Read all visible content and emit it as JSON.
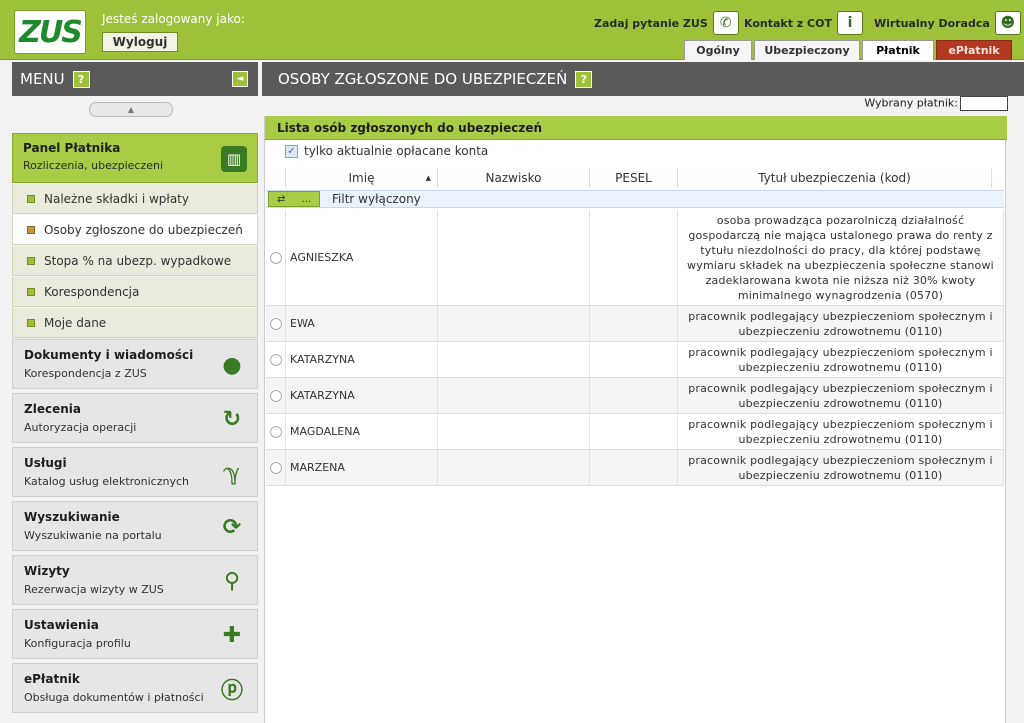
{
  "header": {
    "logo_text": "ZUS",
    "logged_as_label": "Jesteś zalogowany jako:",
    "logout_label": "Wyloguj",
    "links": [
      {
        "label": "Zadaj pytanie ZUS",
        "icon": "chat-bubble-icon"
      },
      {
        "label": "Kontakt z COT",
        "icon": "info-icon"
      },
      {
        "label": "Wirtualny Doradca",
        "icon": "user-icon"
      }
    ],
    "tabs": [
      {
        "label": "Ogólny",
        "state": "normal"
      },
      {
        "label": "Ubezpieczony",
        "state": "normal"
      },
      {
        "label": "Płatnik",
        "state": "active"
      },
      {
        "label": "ePłatnik",
        "state": "red"
      }
    ],
    "accent_color": "#9dc23a",
    "red_tab_color": "#b33821"
  },
  "sidebar": {
    "menu_title": "MENU",
    "help_label": "?",
    "collapse_glyph": "◄",
    "scroll_up_glyph": "▲",
    "panel": {
      "title": "Panel Płatnika",
      "subtitle": "Rozliczenia, ubezpieczeni",
      "icon": "document-stack-icon"
    },
    "items": [
      {
        "label": "Należne składki i wpłaty",
        "selected": false
      },
      {
        "label": "Osoby zgłoszone do ubezpieczeń",
        "selected": true
      },
      {
        "label": "Stopa % na ubezp. wypadkowe",
        "selected": false
      },
      {
        "label": "Korespondencja",
        "selected": false
      },
      {
        "label": "Moje dane",
        "selected": false
      }
    ],
    "groups": [
      {
        "title": "Dokumenty i wiadomości",
        "subtitle": "Korespondencja z ZUS",
        "icon": "speech-bubble-icon"
      },
      {
        "title": "Zlecenia",
        "subtitle": "Autoryzacja operacji",
        "icon": "refresh-icon"
      },
      {
        "title": "Usługi",
        "subtitle": "Katalog usług elektronicznych",
        "icon": "network-icon"
      },
      {
        "title": "Wyszukiwanie",
        "subtitle": "Wyszukiwanie na portalu",
        "icon": "sync-icon"
      },
      {
        "title": "Wizyty",
        "subtitle": "Rezerwacja wizyty w ZUS",
        "icon": "walking-person-icon"
      },
      {
        "title": "Ustawienia",
        "subtitle": "Konfiguracja profilu",
        "icon": "puzzle-icon"
      },
      {
        "title": "ePłatnik",
        "subtitle": "Obsługa dokumentów i płatności",
        "icon": "epayer-icon"
      }
    ]
  },
  "main": {
    "title": "OSOBY ZGŁOSZONE DO UBEZPIECZEŃ",
    "help_label": "?",
    "selected_payer_label": "Wybrany płatnik:",
    "list_title": "Lista osób zgłoszonych do ubezpieczeń",
    "checkbox_label": "tylko aktualnie opłacane konta",
    "checkbox_checked": true,
    "columns": [
      "Imię",
      "Nazwisko",
      "PESEL",
      "Tytuł ubezpieczenia (kod)"
    ],
    "filter_button": "...",
    "filter_label": "Filtr wyłączony",
    "rows": [
      {
        "imie": "AGNIESZKA",
        "nazwisko": "",
        "pesel": "",
        "tytul": "osoba prowadząca pozarolniczą działalność gospodarczą nie mająca ustalonego prawa do renty z tytułu niezdolności do pracy, dla której podstawę wymiaru składek na ubezpieczenia społeczne stanowi zadeklarowana kwota nie niższa niż 30% kwoty minimalnego wynagrodzenia (0570)"
      },
      {
        "imie": "EWA",
        "nazwisko": "",
        "pesel": "",
        "tytul": "pracownik podlegający ubezpieczeniom społecznym i ubezpieczeniu zdrowotnemu (0110)"
      },
      {
        "imie": "KATARZYNA",
        "nazwisko": "",
        "pesel": "",
        "tytul": "pracownik podlegający ubezpieczeniom społecznym i ubezpieczeniu zdrowotnemu (0110)"
      },
      {
        "imie": "KATARZYNA",
        "nazwisko": "",
        "pesel": "",
        "tytul": "pracownik podlegający ubezpieczeniom społecznym i ubezpieczeniu zdrowotnemu (0110)"
      },
      {
        "imie": "MAGDALENA",
        "nazwisko": "",
        "pesel": "",
        "tytul": "pracownik podlegający ubezpieczeniom społecznym i ubezpieczeniu zdrowotnemu (0110)"
      },
      {
        "imie": "MARZENA",
        "nazwisko": "",
        "pesel": "",
        "tytul": "pracownik podlegający ubezpieczeniom społecznym i ubezpieczeniu zdrowotnemu (0110)"
      }
    ]
  }
}
